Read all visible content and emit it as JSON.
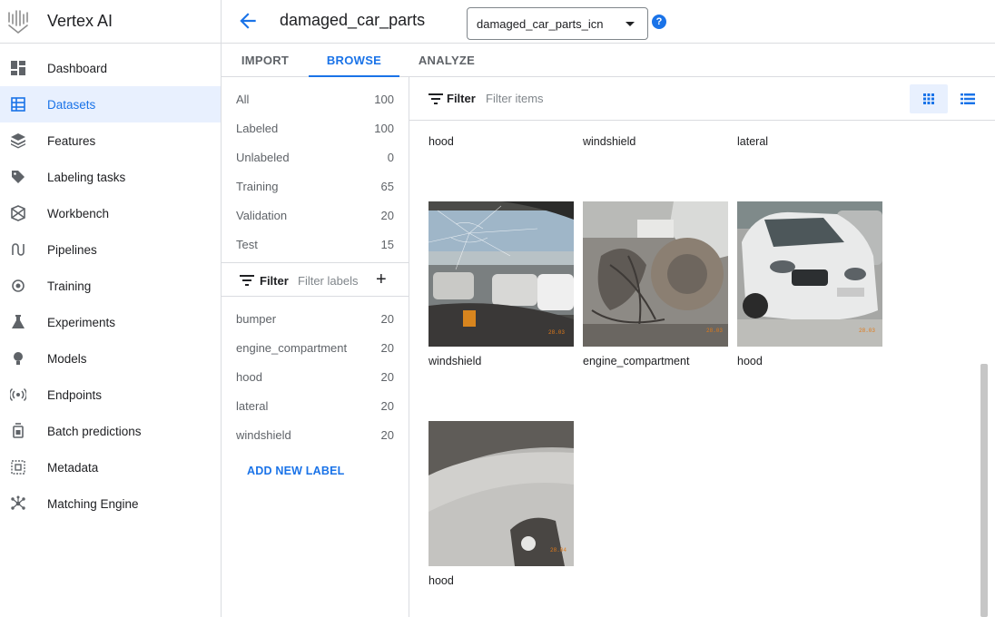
{
  "app": {
    "name": "Vertex AI"
  },
  "nav": {
    "items": [
      {
        "label": "Dashboard",
        "icon": "dashboard-icon"
      },
      {
        "label": "Datasets",
        "icon": "datasets-icon",
        "active": true
      },
      {
        "label": "Features",
        "icon": "features-icon"
      },
      {
        "label": "Labeling tasks",
        "icon": "label-tag-icon"
      },
      {
        "label": "Workbench",
        "icon": "workbench-icon"
      },
      {
        "label": "Pipelines",
        "icon": "pipelines-icon"
      },
      {
        "label": "Training",
        "icon": "training-icon"
      },
      {
        "label": "Experiments",
        "icon": "flask-icon"
      },
      {
        "label": "Models",
        "icon": "lightbulb-icon"
      },
      {
        "label": "Endpoints",
        "icon": "broadcast-icon"
      },
      {
        "label": "Batch predictions",
        "icon": "batch-icon"
      },
      {
        "label": "Metadata",
        "icon": "metadata-icon"
      },
      {
        "label": "Matching Engine",
        "icon": "network-icon"
      }
    ]
  },
  "header": {
    "title": "damaged_car_parts",
    "dataset_select": "damaged_car_parts_icn",
    "help": "?"
  },
  "tabs": [
    {
      "label": "IMPORT"
    },
    {
      "label": "BROWSE",
      "active": true
    },
    {
      "label": "ANALYZE"
    }
  ],
  "splits": [
    {
      "label": "All",
      "count": "100"
    },
    {
      "label": "Labeled",
      "count": "100"
    },
    {
      "label": "Unlabeled",
      "count": "0"
    },
    {
      "label": "Training",
      "count": "65"
    },
    {
      "label": "Validation",
      "count": "20"
    },
    {
      "label": "Test",
      "count": "15"
    }
  ],
  "label_filter": {
    "label": "Filter",
    "placeholder": "Filter labels"
  },
  "labels": [
    {
      "label": "bumper",
      "count": "20"
    },
    {
      "label": "engine_compartment",
      "count": "20"
    },
    {
      "label": "hood",
      "count": "20"
    },
    {
      "label": "lateral",
      "count": "20"
    },
    {
      "label": "windshield",
      "count": "20"
    }
  ],
  "add_label": "ADD NEW LABEL",
  "items_filter": {
    "label": "Filter",
    "placeholder": "Filter items"
  },
  "grid": {
    "top_row_captions": [
      "hood",
      "windshield",
      "lateral"
    ],
    "images": [
      {
        "caption": "windshield",
        "stamp": "28.03"
      },
      {
        "caption": "engine_compartment",
        "stamp": "28.03"
      },
      {
        "caption": "hood",
        "stamp": "28.03"
      },
      {
        "caption": "hood",
        "stamp": "28.04"
      }
    ]
  },
  "colors": {
    "accent": "#1a73e8",
    "active_bg": "#e8f0fe",
    "divider": "#dadce0"
  }
}
